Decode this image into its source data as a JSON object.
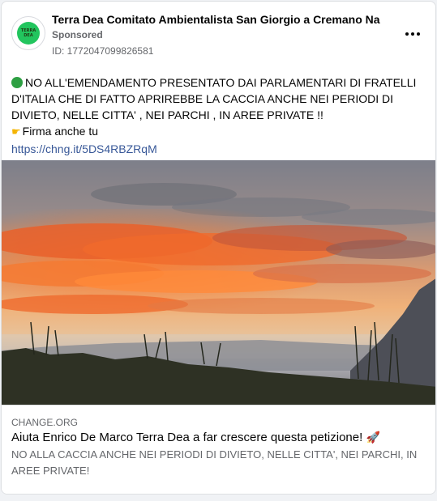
{
  "post": {
    "page_name": "Terra Dea Comitato Ambientalista San Giorgio a Cremano Na",
    "sponsored_label": "Sponsored",
    "ad_id": "ID: 1772047099826581",
    "avatar_text_line1": "TERRA",
    "avatar_text_line2": "DEA",
    "more_icon": "ellipsis-icon",
    "body": {
      "status_icon": "green-circle-icon",
      "main_text": "NO ALL'EMENDAMENTO PRESENTATO DAI PARLAMENTARI DI FRATELLI D'ITALIA CHE DI FATTO APRIREBBE LA CACCIA ANCHE NEI PERIODI DI DIVIETO, NELLE CITTA' , NEI PARCHI , IN AREE PRIVATE !!",
      "cta_icon": "pointing-hand-icon",
      "cta_text": "Firma anche tu",
      "link_text": "https://chng.it/5DS4RBZRqM"
    }
  },
  "link_preview": {
    "domain": "CHANGE.ORG",
    "title": "Aiuta Enrico De Marco Terra Dea a far crescere questa petizione!",
    "title_icon": "rocket-icon",
    "description": "NO ALLA CACCIA ANCHE NEI PERIODI DI DIVIETO, NELLE CITTA', NEI PARCHI, IN AREE PRIVATE!"
  },
  "colors": {
    "link": "#385898",
    "secondary_text": "#65676b",
    "status_green": "#2ea043"
  }
}
